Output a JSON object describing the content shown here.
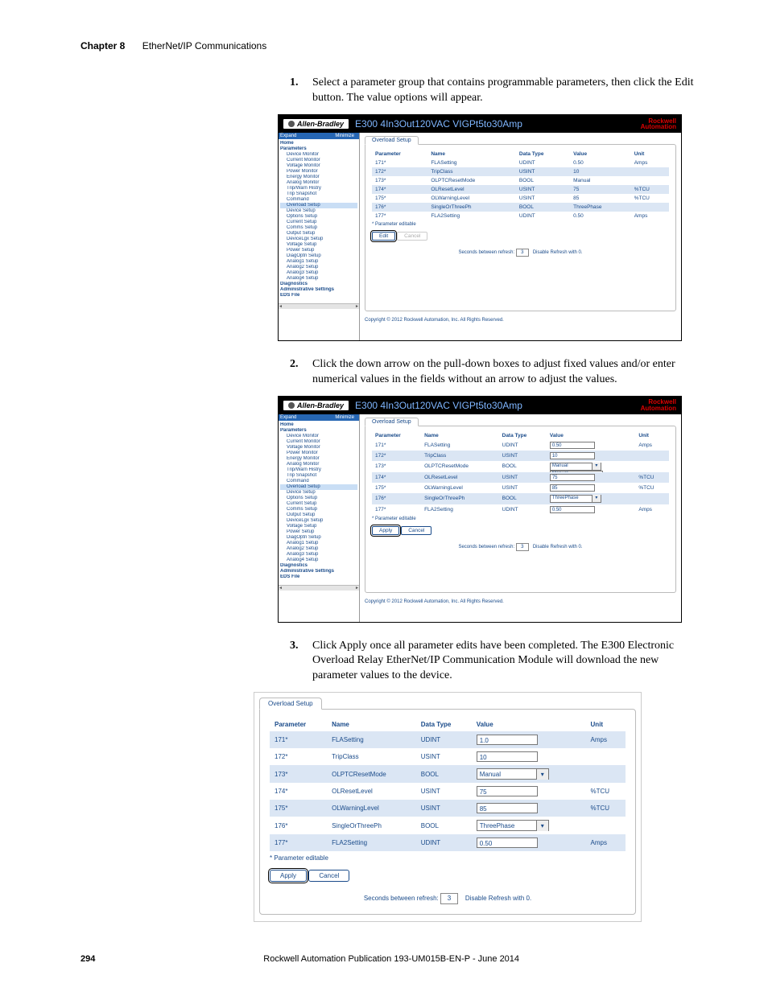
{
  "header": {
    "chapter_label": "Chapter 8",
    "chapter_title": "EtherNet/IP Communications"
  },
  "steps": {
    "s1": {
      "num": "1.",
      "text": "Select a parameter group that contains programmable parameters, then click the Edit button. The value options will appear."
    },
    "s2": {
      "num": "2.",
      "text": "Click the down arrow on the pull-down boxes to adjust fixed values and/or enter numerical values in the fields without an arrow to adjust the values."
    },
    "s3": {
      "num": "3.",
      "text": "Click Apply once all parameter edits have been completed. The E300 Electronic Overload Relay EtherNet/IP Communication Module will download the new parameter values to the device."
    }
  },
  "device": {
    "brand": "Allen-Bradley",
    "title": "E300 4In3Out120VAC VIGPt5to30Amp",
    "vendor_line1": "Rockwell",
    "vendor_line2": "Automation"
  },
  "sidebar": {
    "expand": "Expand",
    "minimize": "Minimize",
    "items": [
      "Home",
      "Parameters",
      "Device Monitor",
      "Current Monitor",
      "Voltage Monitor",
      "Power Monitor",
      "Energy Monitor",
      "Analog Monitor",
      "Trip/Warn Histry",
      "Trip Snapshot",
      "Command",
      "Overload Setup",
      "Device Setup",
      "Options Setup",
      "Current Setup",
      "Comms Setup",
      "Output Setup",
      "DeviceLgx Setup",
      "Voltage Setup",
      "Power Setup",
      "DiagOptn Setup",
      "Analog1 Setup",
      "Analog2 Setup",
      "Analog3 Setup",
      "Analog4 Setup",
      "Diagnostics",
      "Administrative Settings",
      "EDS File"
    ]
  },
  "tab_label": "Overload Setup",
  "table": {
    "headers": {
      "param": "Parameter",
      "name": "Name",
      "dtype": "Data Type",
      "value": "Value",
      "unit": "Unit"
    },
    "rows": [
      {
        "param": "171*",
        "name": "FLASetting",
        "dtype": "UDINT",
        "value": "0.50",
        "unit": "Amps"
      },
      {
        "param": "172*",
        "name": "TripClass",
        "dtype": "USINT",
        "value": "10",
        "unit": ""
      },
      {
        "param": "173*",
        "name": "OLPTCResetMode",
        "dtype": "BOOL",
        "value": "Manual",
        "unit": ""
      },
      {
        "param": "174*",
        "name": "OLResetLevel",
        "dtype": "USINT",
        "value": "75",
        "unit": "%TCU"
      },
      {
        "param": "175*",
        "name": "OLWarningLevel",
        "dtype": "USINT",
        "value": "85",
        "unit": "%TCU"
      },
      {
        "param": "176*",
        "name": "SingleOrThreePh",
        "dtype": "BOOL",
        "value": "ThreePhase",
        "unit": ""
      },
      {
        "param": "177*",
        "name": "FLA2Setting",
        "dtype": "UDINT",
        "value": "0.50",
        "unit": "Amps"
      }
    ]
  },
  "shot2": {
    "rows": [
      {
        "param": "171*",
        "name": "FLASetting",
        "dtype": "UDINT",
        "value": "0.50",
        "unit": "Amps",
        "ctrl": "input"
      },
      {
        "param": "172*",
        "name": "TripClass",
        "dtype": "USINT",
        "value": "10",
        "unit": "",
        "ctrl": "input"
      },
      {
        "param": "173*",
        "name": "OLPTCResetMode",
        "dtype": "BOOL",
        "value": "Manual",
        "unit": "",
        "ctrl": "select",
        "options": [
          "Manual",
          "Automatic"
        ]
      },
      {
        "param": "174*",
        "name": "OLResetLevel",
        "dtype": "USINT",
        "value": "75",
        "unit": "%TCU",
        "ctrl": "input_under_dropdown"
      },
      {
        "param": "175*",
        "name": "OLWarningLevel",
        "dtype": "USINT",
        "value": "85",
        "unit": "%TCU",
        "ctrl": "input"
      },
      {
        "param": "176*",
        "name": "SingleOrThreePh",
        "dtype": "BOOL",
        "value": "ThreePhase",
        "unit": "",
        "ctrl": "select"
      },
      {
        "param": "177*",
        "name": "FLA2Setting",
        "dtype": "UDINT",
        "value": "0.50",
        "unit": "Amps",
        "ctrl": "input"
      }
    ]
  },
  "shot3": {
    "rows": [
      {
        "param": "171*",
        "name": "FLASetting",
        "dtype": "UDINT",
        "value": "1.0",
        "unit": "Amps",
        "ctrl": "input"
      },
      {
        "param": "172*",
        "name": "TripClass",
        "dtype": "USINT",
        "value": "10",
        "unit": "",
        "ctrl": "input"
      },
      {
        "param": "173*",
        "name": "OLPTCResetMode",
        "dtype": "BOOL",
        "value": "Manual",
        "unit": "",
        "ctrl": "select"
      },
      {
        "param": "174*",
        "name": "OLResetLevel",
        "dtype": "USINT",
        "value": "75",
        "unit": "%TCU",
        "ctrl": "input"
      },
      {
        "param": "175*",
        "name": "OLWarningLevel",
        "dtype": "USINT",
        "value": "85",
        "unit": "%TCU",
        "ctrl": "input"
      },
      {
        "param": "176*",
        "name": "SingleOrThreePh",
        "dtype": "BOOL",
        "value": "ThreePhase",
        "unit": "",
        "ctrl": "select"
      },
      {
        "param": "177*",
        "name": "FLA2Setting",
        "dtype": "UDINT",
        "value": "0.50",
        "unit": "Amps",
        "ctrl": "input"
      }
    ]
  },
  "param_note": "* Parameter editable",
  "buttons": {
    "edit": "Edit",
    "apply": "Apply",
    "cancel": "Cancel"
  },
  "refresh": {
    "label_before": "Seconds between refresh:",
    "value": "3",
    "label_after": "Disable Refresh with 0."
  },
  "copyright": "Copyright © 2012 Rockwell Automation, Inc. All Rights Reserved.",
  "footer": {
    "page": "294",
    "pub": "Rockwell Automation Publication 193-UM015B-EN-P - June 2014"
  }
}
